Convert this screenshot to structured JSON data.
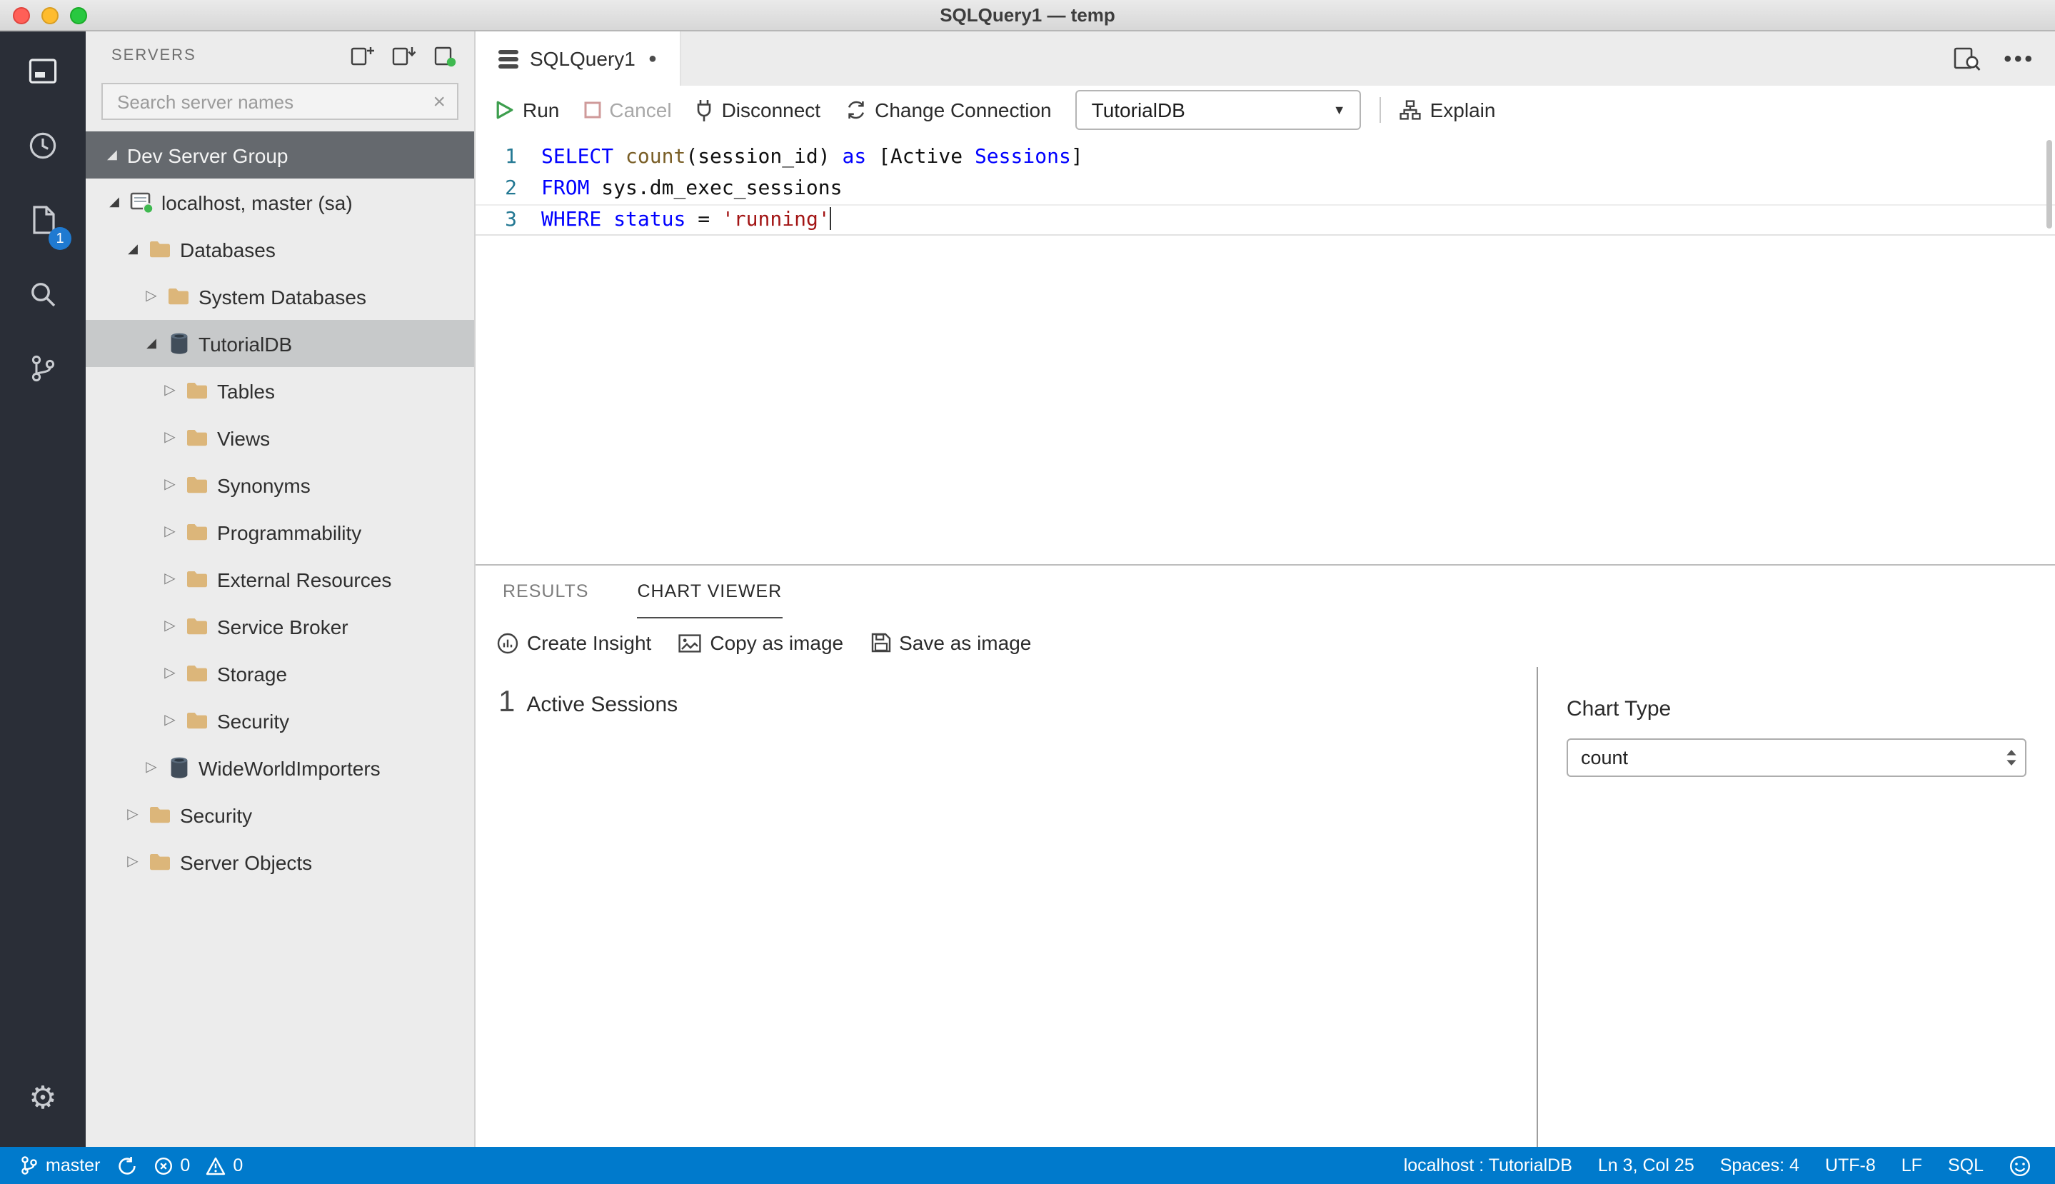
{
  "window": {
    "title": "SQLQuery1 — temp"
  },
  "activity_bar": {
    "items": [
      "connections",
      "task-history",
      "explorer",
      "search",
      "source-control",
      "settings"
    ],
    "badge": "1"
  },
  "sidebar": {
    "title": "SERVERS",
    "search": {
      "placeholder": "Search server names"
    },
    "group_label": "Dev Server Group",
    "tree": [
      {
        "label": "localhost, master (sa)",
        "icon": "server",
        "depth": 1,
        "expanded": true
      },
      {
        "label": "Databases",
        "icon": "folder",
        "depth": 2,
        "expanded": true
      },
      {
        "label": "System Databases",
        "icon": "folder",
        "depth": 3,
        "expanded": false
      },
      {
        "label": "TutorialDB",
        "icon": "database",
        "depth": 3,
        "expanded": true,
        "selected": true
      },
      {
        "label": "Tables",
        "icon": "folder",
        "depth": 4,
        "expanded": false
      },
      {
        "label": "Views",
        "icon": "folder",
        "depth": 4,
        "expanded": false
      },
      {
        "label": "Synonyms",
        "icon": "folder",
        "depth": 4,
        "expanded": false
      },
      {
        "label": "Programmability",
        "icon": "folder",
        "depth": 4,
        "expanded": false
      },
      {
        "label": "External Resources",
        "icon": "folder",
        "depth": 4,
        "expanded": false
      },
      {
        "label": "Service Broker",
        "icon": "folder",
        "depth": 4,
        "expanded": false
      },
      {
        "label": "Storage",
        "icon": "folder",
        "depth": 4,
        "expanded": false
      },
      {
        "label": "Security",
        "icon": "folder",
        "depth": 4,
        "expanded": false
      },
      {
        "label": "WideWorldImporters",
        "icon": "database",
        "depth": 3,
        "expanded": false
      },
      {
        "label": "Security",
        "icon": "folder",
        "depth": 2,
        "expanded": false
      },
      {
        "label": "Server Objects",
        "icon": "folder",
        "depth": 2,
        "expanded": false
      }
    ]
  },
  "editor": {
    "tab_label": "SQLQuery1",
    "toolbar": {
      "run": "Run",
      "cancel": "Cancel",
      "disconnect": "Disconnect",
      "change_connection": "Change Connection",
      "database_value": "TutorialDB",
      "explain": "Explain"
    },
    "code_lines": [
      {
        "num": "1",
        "tokens": [
          [
            "SELECT",
            "kw"
          ],
          [
            " ",
            "pl"
          ],
          [
            "count",
            "fn"
          ],
          [
            "(session_id) ",
            "pl"
          ],
          [
            "as",
            "kw"
          ],
          [
            " [Active ",
            "pl"
          ],
          [
            "Sessions",
            "kw"
          ],
          [
            "]",
            "pl"
          ]
        ]
      },
      {
        "num": "2",
        "tokens": [
          [
            "FROM",
            "kw"
          ],
          [
            " sys.dm_exec_sessions",
            "pl"
          ]
        ]
      },
      {
        "num": "3",
        "tokens": [
          [
            "WHERE",
            "kw"
          ],
          [
            " ",
            "pl"
          ],
          [
            "status",
            "kw"
          ],
          [
            " = ",
            "pl"
          ],
          [
            "'running'",
            "str"
          ]
        ],
        "current": true
      }
    ]
  },
  "results": {
    "tabs": [
      {
        "label": "RESULTS",
        "active": false
      },
      {
        "label": "CHART VIEWER",
        "active": true
      }
    ],
    "actions": [
      {
        "label": "Create Insight"
      },
      {
        "label": "Copy as image"
      },
      {
        "label": "Save as image"
      }
    ],
    "chart": {
      "value": "1",
      "label": "Active Sessions"
    },
    "options": {
      "title": "Chart Type",
      "selected": "count"
    }
  },
  "status_bar": {
    "branch": "master",
    "errors": "0",
    "warnings": "0",
    "connection": "localhost : TutorialDB",
    "cursor": "Ln 3, Col 25",
    "indent": "Spaces: 4",
    "encoding": "UTF-8",
    "eol": "LF",
    "language": "SQL"
  },
  "colors": {
    "status_bar": "#007acc",
    "activity_bar": "#2a2e37",
    "badge": "#1f7ad1",
    "keyword": "#0000ff",
    "string": "#a31515",
    "function": "#795e26",
    "folder_icon": "#dcb67a"
  }
}
